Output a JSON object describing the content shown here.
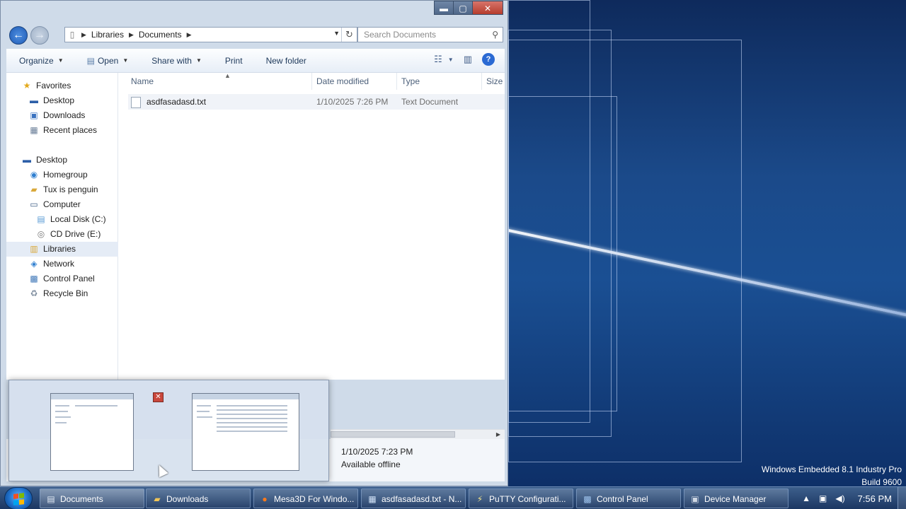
{
  "explorer": {
    "window_controls": {
      "minimize": "▬",
      "maximize": "▢",
      "close": "✕"
    },
    "address_bar": {
      "crumbs": [
        "Libraries",
        "Documents"
      ]
    },
    "search": {
      "placeholder": "Search Documents"
    },
    "toolbar": {
      "organize": "Organize",
      "open": "Open",
      "share_with": "Share with",
      "print": "Print",
      "new_folder": "New folder"
    },
    "nav_pane": {
      "items": [
        {
          "label": "Favorites",
          "icon": "star-icon"
        },
        {
          "label": "Desktop",
          "icon": "desktop-icon"
        },
        {
          "label": "Downloads",
          "icon": "downloads-icon"
        },
        {
          "label": "Recent places",
          "icon": "recent-places-icon"
        },
        {
          "label": "Desktop",
          "icon": "desktop-icon"
        },
        {
          "label": "Homegroup",
          "icon": "homegroup-icon"
        },
        {
          "label": "Tux is penguin",
          "icon": "user-folder-icon"
        },
        {
          "label": "Computer",
          "icon": "computer-icon"
        },
        {
          "label": "Local Disk (C:)",
          "icon": "disk-icon"
        },
        {
          "label": "CD Drive (E:)",
          "icon": "cd-drive-icon"
        },
        {
          "label": "Libraries",
          "icon": "libraries-icon",
          "selected": true
        },
        {
          "label": "Network",
          "icon": "network-icon"
        },
        {
          "label": "Control Panel",
          "icon": "control-panel-icon"
        },
        {
          "label": "Recycle Bin",
          "icon": "recycle-bin-icon"
        }
      ]
    },
    "columns": {
      "name": "Name",
      "date_modified": "Date modified",
      "type": "Type",
      "size": "Size"
    },
    "files": [
      {
        "name": "asdfasadasd.txt",
        "date_modified": "1/10/2025 7:26 PM",
        "type": "Text Document"
      }
    ],
    "details": {
      "date_value": "1/10/2025 7:23 PM",
      "availability": "Available offline"
    }
  },
  "desktop": {
    "watermark_line1": "Windows Embedded 8.1 Industry Pro",
    "watermark_line2": "Build 9600"
  },
  "taskbar": {
    "tasks": [
      {
        "label": "Documents",
        "icon": "explorer-icon",
        "active": true
      },
      {
        "label": "Downloads",
        "icon": "folder-icon"
      },
      {
        "label": "Mesa3D For Windo...",
        "icon": "firefox-icon"
      },
      {
        "label": "asdfasadasd.txt - N...",
        "icon": "notepad-icon"
      },
      {
        "label": "PuTTY Configurati...",
        "icon": "putty-icon"
      },
      {
        "label": "Control Panel",
        "icon": "control-panel-icon"
      },
      {
        "label": "Device Manager",
        "icon": "device-manager-icon"
      }
    ],
    "clock": "7:56 PM"
  },
  "colors": {
    "desktop_blue": "#1b4a8a",
    "selection": "#e5ecf6",
    "accent": "#2b6ad3"
  }
}
